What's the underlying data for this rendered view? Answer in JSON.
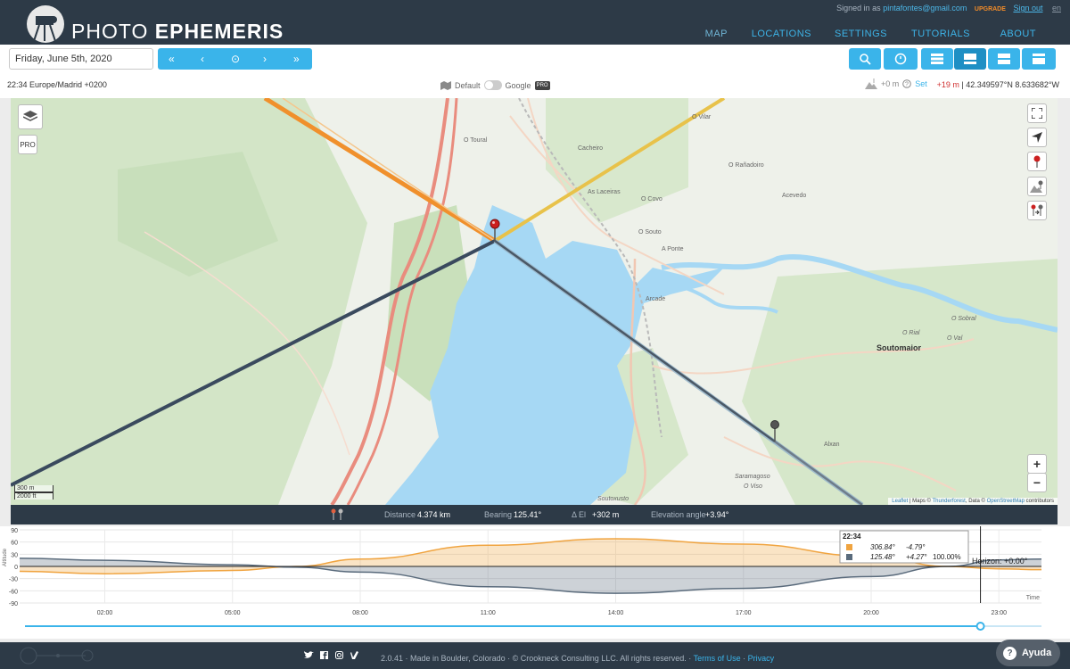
{
  "header": {
    "brand_light": "PHOTO",
    "brand_bold": "EPHEMERIS",
    "signed_in_prefix": "Signed in as",
    "email": "pintafontes@gmail.com",
    "upgrade": "UPGRADE",
    "sign_out": "Sign out",
    "language": "en",
    "nav": [
      "MAP",
      "LOCATIONS",
      "SETTINGS",
      "TUTORIALS",
      "ABOUT"
    ]
  },
  "toolbar": {
    "date": "Friday, June 5th, 2020",
    "nav_buttons": [
      "«",
      "‹",
      "⊙",
      "›",
      "»"
    ],
    "timezone": "22:34 Europe/Madrid +0200",
    "map_default": "Default",
    "map_google": "Google",
    "pro": "PRO",
    "elevation": "+0 m",
    "set": "Set",
    "height": "+19 m",
    "coordinates": "| 42.349597°N 8.633682°W"
  },
  "map": {
    "places": [
      "O Toural",
      "Cacheiro",
      "O Vilar",
      "O Rañadoiro",
      "As Laceiras",
      "O Covo",
      "Acevedo",
      "O Souto",
      "A Ponte",
      "Arcade",
      "O Rial",
      "O Sobral",
      "O Val",
      "Soutomaior",
      "Alxan",
      "Saramagoso",
      "O Viso",
      "Soutoxusto"
    ],
    "scale_metric": "300 m",
    "scale_imperial": "2000 ft",
    "pro": "PRO",
    "zoom_in": "+",
    "zoom_out": "−",
    "attribution": {
      "leaflet": "Leaflet",
      "maps_prefix": " | Maps © ",
      "thunderforest": "Thunderforest",
      "data_prefix": ", Data © ",
      "osm": "OpenStreetMap",
      "suffix": " contributors"
    },
    "colors": {
      "sunset_line": "#f0902c",
      "moonrise_line": "#e8c24a",
      "moon_line": "#3a4a5e",
      "geodetic_line": "#9ab8cc",
      "secondary_line": "#4a5866",
      "water": "#a6d8f4",
      "land": "#eef1ea",
      "forest": "#cfe2c2",
      "road_major": "#e98c7e",
      "pin": "#cc1f1f"
    }
  },
  "stats": {
    "distance_label": "Distance",
    "distance": "4.374 km",
    "bearing_label": "Bearing",
    "bearing": "125.41°",
    "delta_label": "Δ El",
    "delta": "+302 m",
    "angle_label": "Elevation angle",
    "angle": "+3.94°"
  },
  "chart_data": {
    "type": "area",
    "ylabel": "Altitude",
    "xlabel": "Time",
    "ylim": [
      -90,
      90
    ],
    "yticks": [
      90,
      60,
      30,
      0,
      -30,
      -60,
      -90
    ],
    "xticks": [
      "02:00",
      "05:00",
      "08:00",
      "11:00",
      "14:00",
      "17:00",
      "20:00",
      "23:00"
    ],
    "x_hours": [
      0,
      2,
      5,
      6.5,
      8,
      11,
      14,
      17,
      20,
      21.8,
      23,
      24
    ],
    "series": [
      {
        "color": "#f0a440",
        "values": [
          -12,
          -18,
          -10,
          0,
          18,
          52,
          68,
          55,
          25,
          0,
          -6,
          -8
        ]
      },
      {
        "color": "#5a6b7c",
        "values": [
          20,
          15,
          4,
          -2,
          -14,
          -50,
          -66,
          -54,
          -25,
          0,
          16,
          18
        ]
      }
    ],
    "current_time": "22:34",
    "current_hour": 22.567,
    "horizon_label": "Horizon: +0.00°",
    "tooltip": {
      "time": "22:34",
      "rows": [
        {
          "color": "#f0a440",
          "azimuth": "306.84°",
          "altitude": "-4.79°",
          "extra": ""
        },
        {
          "color": "#5a6b7c",
          "azimuth": "125.48°",
          "altitude": "+4.27°",
          "extra": "100.00%"
        }
      ]
    }
  },
  "footer": {
    "social": [
      "twitter",
      "facebook",
      "instagram",
      "vimeo"
    ],
    "copyright": "2.0.41 · Made in Boulder, Colorado · © Crookneck Consulting LLC. All rights reserved. · ",
    "terms": "Terms of Use",
    "sep": " · ",
    "privacy": "Privacy",
    "help": "Ayuda"
  }
}
